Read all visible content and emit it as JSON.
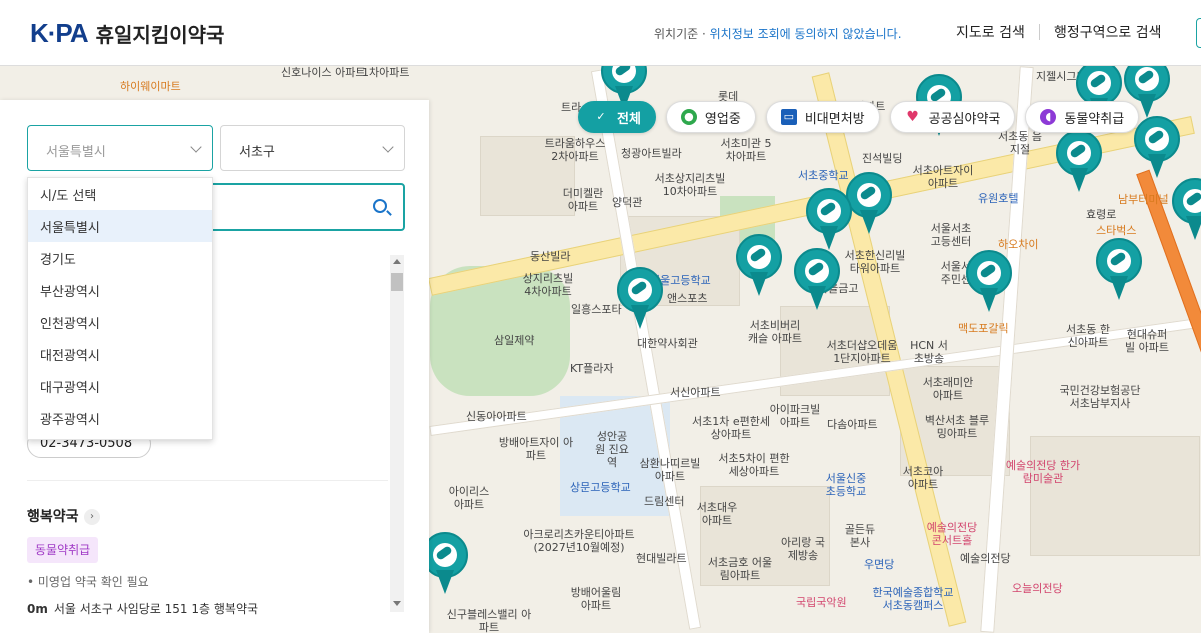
{
  "header": {
    "logo_mark": "K·PA",
    "logo_text": "휴일지킴이약국",
    "location_prefix": "위치기준 · ",
    "location_message": "위치정보 조회에 동의하지 않았습니다.",
    "nav": [
      "지도로 검색",
      "행정구역으로 검색"
    ]
  },
  "filters": [
    {
      "label": "전체",
      "icon": "check-icon",
      "active": true
    },
    {
      "label": "영업중",
      "icon": "location-pin-icon"
    },
    {
      "label": "비대면처방",
      "icon": "monitor-icon"
    },
    {
      "label": "공공심야약국",
      "icon": "heart-pulse-icon"
    },
    {
      "label": "동물약취급",
      "icon": "capsule-icon"
    }
  ],
  "panel": {
    "sido_placeholder": "서울특별시",
    "sigungu_value": "서초구",
    "dropdown": [
      "시/도 선택",
      "서울특별시",
      "경기도",
      "부산광역시",
      "인천광역시",
      "대전광역시",
      "대구광역시",
      "광주광역시"
    ],
    "phone": "02-3473-0508",
    "pharmacy": {
      "name": "행복약국",
      "tag": "동물약취급",
      "status": "• 미영업   약국 확인 필요",
      "distance": "0m",
      "address": "서울 서초구 사임당로 151 1층 행복약국"
    }
  },
  "map_labels": [
    "신호나이스 아파트",
    "1차아파트",
    "하이웨이마트",
    "트라",
    "롯데",
    "아파트",
    "트라움하우스 2차아파트",
    "청광아트빌라",
    "서초미관 5차아파트",
    "더미켈란 아파트",
    "서초상지리츠빌 10차아파트",
    "양덕관",
    "동산빌라",
    "상지리츠빌 4차아파트",
    "일흥스포타",
    "서울고등학교",
    "앤스포츠",
    "삼일제약",
    "대한약사회관",
    "서초비버리캐슬 아파트",
    "서초더샵오데움 1단지아파트",
    "KT플라자",
    "HCN 서초방송",
    "서초래미안 아파트",
    "서신아파트",
    "서초1차 e편한세상아파트",
    "아이파크빌 아파트",
    "다솜아파트",
    "벽산서초 블루밍아파트",
    "국민건강보험공단 서초남부지사",
    "신동아아파트",
    "방배아트자이 아파트",
    "성안공원 진요역",
    "상문고등학교",
    "삼환나띠르빌 아파트",
    "서초5차이 편한세상아파트",
    "서울신중 초등학교",
    "서초코아 아파트",
    "예술의전당 한가람미술관",
    "아이리스 아파트",
    "드림센터",
    "서초대우 아파트",
    "아크로리츠카운티아파트 (2027년10월예정)",
    "현대빌라트",
    "서초금호 어울림아파트",
    "아리랑 국제방송",
    "골든듀 본사",
    "예술의전당 콘서트홀",
    "예술의전당",
    "방배어울림 아파트",
    "우면당",
    "국립국악원",
    "한국예술종합학교 서초동캠퍼스",
    "신구블레스밸리 아파트",
    "서초아트자이 아파트",
    "유원호텔",
    "스타벅스",
    "하오차이",
    "서울서초 고등센터",
    "서초한신리빌 타워아파트",
    "마을금고",
    "서울서초 주민센터",
    "맥도포갈릭",
    "서초동 한신아파트",
    "현대슈퍼빌 아파트",
    "남부터미널",
    "진석빌딩",
    "효령로",
    "지젤시그니",
    "서초중학교",
    "서초동 음지절",
    "예술의전당",
    "오늘의전당"
  ]
}
